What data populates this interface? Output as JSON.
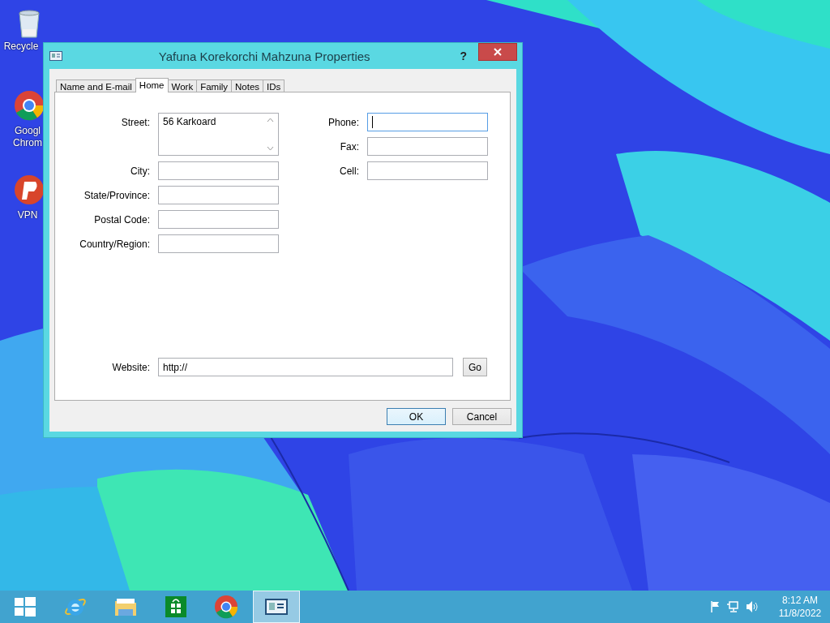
{
  "desktop_icons": [
    {
      "kind": "bin",
      "label": "Recycle"
    },
    {
      "kind": "chrome",
      "label": "Googl Chrom"
    },
    {
      "kind": "vpn",
      "label": "VPN"
    }
  ],
  "dialog": {
    "title": "Yafuna Korekorchi Mahzuna Properties",
    "help": "?",
    "tabs": [
      {
        "label": "Name and E-mail",
        "selected": false
      },
      {
        "label": "Home",
        "selected": true
      },
      {
        "label": "Work",
        "selected": false
      },
      {
        "label": "Family",
        "selected": false
      },
      {
        "label": "Notes",
        "selected": false
      },
      {
        "label": "IDs",
        "selected": false
      }
    ],
    "left_fields": [
      {
        "label": "Street:",
        "value": "56 Karkoard",
        "kind": "multiline",
        "focused": false
      },
      {
        "label": "City:",
        "kind": "line",
        "focused": false
      },
      {
        "label": "State/Province:",
        "kind": "line",
        "focused": false
      },
      {
        "label": "Postal Code:",
        "kind": "line",
        "focused": false
      },
      {
        "label": "Country/Region:",
        "kind": "line",
        "focused": false
      }
    ],
    "right_fields": [
      {
        "label": "Phone:",
        "kind": "line",
        "focused": true
      },
      {
        "label": "Fax:",
        "kind": "line",
        "focused": false
      },
      {
        "label": "Cell:",
        "kind": "line",
        "focused": false
      }
    ],
    "website": {
      "label": "Website:",
      "value": "http://",
      "button": "Go"
    },
    "buttons": [
      {
        "label": "OK",
        "default": true
      },
      {
        "label": "Cancel",
        "default": false
      }
    ]
  },
  "taskbar": {
    "apps": [
      {
        "kind": "start",
        "selected": false
      },
      {
        "kind": "ie",
        "selected": false
      },
      {
        "kind": "explorer",
        "selected": false
      },
      {
        "kind": "store",
        "selected": false
      },
      {
        "kind": "chrome",
        "selected": false
      },
      {
        "kind": "contacts",
        "selected": true
      }
    ],
    "tray": {
      "time": "8:12 AM",
      "date": "11/8/2022"
    }
  }
}
